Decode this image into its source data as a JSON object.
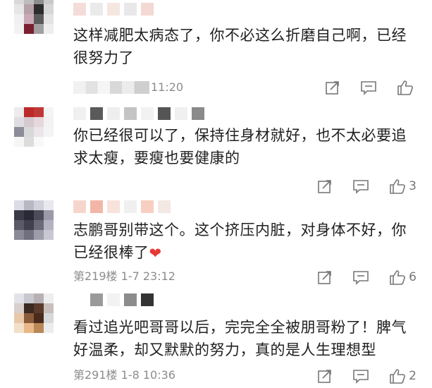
{
  "comments": [
    {
      "text": "这样减肥太病态了，你不必这么折磨自己啊，已经很努力了",
      "meta_time": "11:20",
      "share_count": "",
      "reply_count": "",
      "like_count": ""
    },
    {
      "text": "你已经很可以了，保持住身材就好，也不太必要追求太瘦，要瘦也要健康的",
      "meta_time": "",
      "share_count": "",
      "reply_count": "",
      "like_count": "3"
    },
    {
      "text": "志鹏哥别带这个。这个挤压内脏，对身体不好，你已经很棒了",
      "heart": "❤",
      "meta_time": "第219楼  1-7  23:12",
      "share_count": "",
      "reply_count": "",
      "like_count": "6"
    },
    {
      "text": "看过追光吧哥哥以后，完完全全被朋哥粉了！脾气好温柔，却又默默的努力，真的是人生理想型",
      "meta_time": "第291楼  1-8  10:36",
      "share_count": "",
      "reply_count": "",
      "like_count": "2"
    }
  ],
  "icons": {
    "share": "share-icon",
    "reply": "comment-icon",
    "like": "thumbs-up-icon"
  },
  "colors": {
    "heart": "#e53935",
    "meta": "#8c8c8c",
    "text": "#1f1f1f"
  }
}
